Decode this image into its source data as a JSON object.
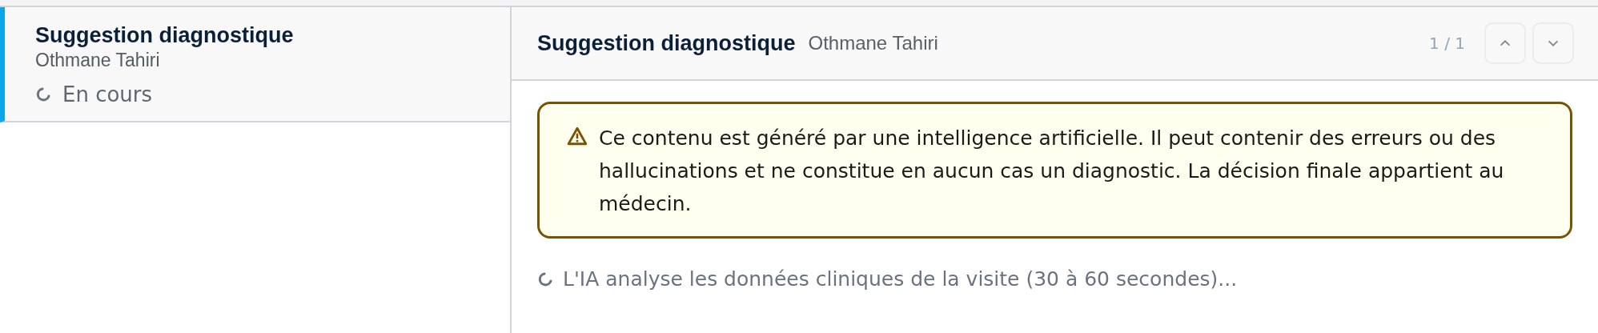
{
  "requests": [
    {
      "title": "Suggestion diagnostique",
      "patient": "Othmane Tahiri",
      "status": "En cours",
      "pending": true,
      "selected": true
    }
  ],
  "detail": {
    "title": "Suggestion diagnostique",
    "patient": "Othmane Tahiri",
    "counter": "1 / 1",
    "prev_disabled": true,
    "next_disabled": true,
    "warning": "Ce contenu est généré par une intelligence artificielle. Il peut contenir des erreurs ou des hallucinations et ne constitue en aucun cas un diagnostic. La décision finale appartient au médecin.",
    "progress": {
      "pending": true,
      "text": "L'IA analyse les données cliniques de la visite (30 à 60 secondes)..."
    }
  }
}
